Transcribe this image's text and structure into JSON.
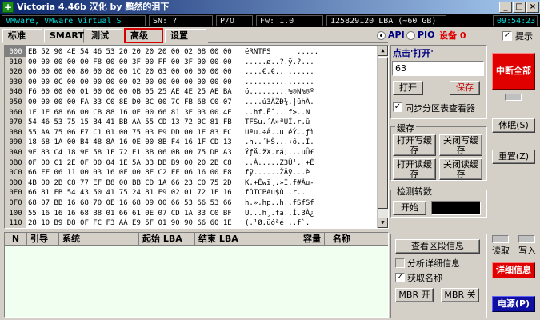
{
  "window": {
    "title": "Victoria 4.46b 汉化 by 黯然的泪下",
    "app_icon": "plus-icon",
    "buttons": [
      "_",
      "□",
      "×"
    ]
  },
  "status": {
    "device": "VMware, VMware Virtual S",
    "sn": "SN: ?",
    "pio": "P/O",
    "fw": "Fw: 1.0",
    "lba": "125829120 LBA (~60 GB)",
    "clock": "09:54:23"
  },
  "tabs": [
    "标准",
    "SMART",
    "测试",
    "高级",
    "设置"
  ],
  "mode": {
    "api": "API",
    "pio": "PIO",
    "device_label": "设备 0",
    "hint": "提示"
  },
  "hex": {
    "rows": [
      {
        "off": "000",
        "hex": "EB 52 90 4E 54 46 53 20 20 20 20 00 02 08 00 00",
        "asc": "ëRNTFS      ....."
      },
      {
        "off": "010",
        "hex": "00 00 00 00 00 F8 00 00 3F 00 FF 00 3F 00 00 00",
        "asc": ".....ø..?.ÿ.?..."
      },
      {
        "off": "020",
        "hex": "00 00 00 00 80 00 80 00 1C 20 03 00 00 00 00 00",
        "asc": "....€.€.. ......"
      },
      {
        "off": "030",
        "hex": "00 00 0C 00 00 00 00 00 02 00 00 00 00 00 00 00",
        "asc": "................"
      },
      {
        "off": "040",
        "hex": "F6 00 00 00 01 00 00 00 0B 05 25 AE 4E 25 AE BA",
        "asc": "ö.........%®N%®º"
      },
      {
        "off": "050",
        "hex": "00 00 00 00 FA 33 C0 8E D0 BC 00 7C FB 68 C0 07",
        "asc": "....ú3ÀŽÐ¼.|ûhÀ."
      },
      {
        "off": "060",
        "hex": "1F 1E 68 66 00 CB 88 16 0E 00 66 81 3E 03 00 4E",
        "asc": "..hf.Ëˆ...f>..N"
      },
      {
        "off": "070",
        "hex": "54 46 53 75 15 B4 41 BB AA 55 CD 13 72 0C 81 FB",
        "asc": "TFSu.´A»ªUÍ.r.û"
      },
      {
        "off": "080",
        "hex": "55 AA 75 06 F7 C1 01 00 75 03 E9 DD 00 1E 83 EC",
        "asc": "Uªu.÷Á..u.éÝ..ƒì"
      },
      {
        "off": "090",
        "hex": "18 68 1A 00 B4 48 8A 16 0E 00 8B F4 16 1F CD 13",
        "asc": ".h..´HŠ...‹ô..Í."
      },
      {
        "off": "0A0",
        "hex": "9F 83 C4 18 9E 58 1F 72 E1 3B 06 0B 00 75 DB A3",
        "asc": "ŸƒÄ.žX.rá;...uÛ£"
      },
      {
        "off": "0B0",
        "hex": "0F 00 C1 2E 0F 00 04 1E 5A 33 DB B9 00 20 2B C8",
        "asc": "..Á.....Z3Û¹. +È"
      },
      {
        "off": "0C0",
        "hex": "66 FF 06 11 00 03 16 0F 00 8E C2 FF 06 16 00 E8",
        "asc": "fÿ......ŽÂÿ...è"
      },
      {
        "off": "0D0",
        "hex": "4B 00 2B C8 77 EF B8 00 BB CD 1A 66 23 C0 75 2D",
        "asc": "K.+Èwï¸.»Í.f#Àu-"
      },
      {
        "off": "0E0",
        "hex": "66 81 FB 54 43 50 41 75 24 81 F9 02 01 72 1E 16",
        "asc": "fûTCPAu$ù..r.."
      },
      {
        "off": "0F0",
        "hex": "68 07 BB 16 68 70 0E 16 68 09 00 66 53 66 53 66",
        "asc": "h.».hp..h..fSfSf"
      },
      {
        "off": "100",
        "hex": "55 16 16 16 68 B8 01 66 61 0E 07 CD 1A 33 C0 BF",
        "asc": "U...h¸.fa..Í.3À¿"
      },
      {
        "off": "110",
        "hex": "28 10 B9 D8 0F FC F3 AA E9 5F 01 90 90 66 60 1E",
        "asc": "(.¹Ø.üóªé_..f`."
      }
    ]
  },
  "partitions": {
    "columns": [
      "N",
      "引导",
      "系统",
      "起始 LBA",
      "结束 LBA",
      "容量",
      "名称"
    ]
  },
  "controls": {
    "click_open": "点击'打开'",
    "lba_value": "63",
    "open": "打开",
    "save": "保存",
    "sync_partition": "同步分区表查看器",
    "cache_title": "缓存",
    "open_write_cache": "打开写缓存",
    "close_write_cache": "关闭写缓存",
    "open_read_cache": "打开读缓存",
    "close_read_cache": "关闭读缓存",
    "rpm_title": "检测转数",
    "start": "开始",
    "view_sector": "查看区段信息",
    "analyze_detail": "分析详细信息",
    "get_name": "获取名称",
    "mbr_on": "MBR 开",
    "mbr_off": "MBR 关"
  },
  "side": {
    "abort_all": "中断全部",
    "sleep": "休眠(S)",
    "reset": "重置(Z)",
    "read": "读取",
    "write": "写入",
    "details": "详细信息",
    "power": "电源(P)"
  },
  "colors": {
    "accent_red": "#e00000",
    "power_blue": "#1010a0",
    "status_bg": "#000000"
  }
}
